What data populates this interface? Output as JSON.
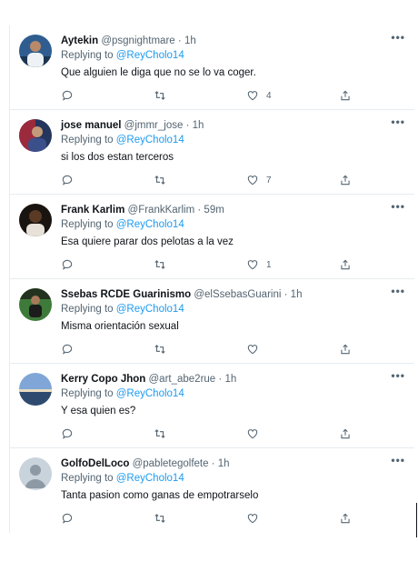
{
  "ui": {
    "more_label": "•••",
    "replying_prefix": "Replying to",
    "dot": "·"
  },
  "tweets": [
    {
      "name": "Aytekin",
      "handle": "@psgnightmare",
      "time": "1h",
      "replying_to": "@ReyCholo14",
      "text": "Que alguien le diga que no se lo va coger.",
      "likes": "4",
      "avatar_color": "#3a6fb0"
    },
    {
      "name": "jose manuel",
      "handle": "@jmmr_jose",
      "time": "1h",
      "replying_to": "@ReyCholo14",
      "text": "si los dos estan terceros",
      "likes": "7",
      "avatar_color": "#8a3a4a"
    },
    {
      "name": "Frank Karlim",
      "handle": "@FrankKarlim",
      "time": "59m",
      "replying_to": "@ReyCholo14",
      "text": "Esa quiere parar dos pelotas a la vez",
      "likes": "1",
      "avatar_color": "#2b1f18"
    },
    {
      "name": "Ssebas RCDE Guarinismo",
      "handle": "@elSsebasGuarini",
      "time": "1h",
      "replying_to": "@ReyCholo14",
      "text": "Misma orientación sexual",
      "likes": "",
      "avatar_color": "#3c6b3a"
    },
    {
      "name": "Kerry Copo Jhon",
      "handle": "@art_abe2rue",
      "time": "1h",
      "replying_to": "@ReyCholo14",
      "text": "Y esa quien es?",
      "likes": "",
      "avatar_color": "#5f86b8"
    },
    {
      "name": "GolfoDelLoco",
      "handle": "@pabletegolfete",
      "time": "1h",
      "replying_to": "@ReyCholo14",
      "text": "Tanta pasion como ganas de empotrarselo",
      "likes": "",
      "avatar_color": "#c9d3dc"
    }
  ]
}
